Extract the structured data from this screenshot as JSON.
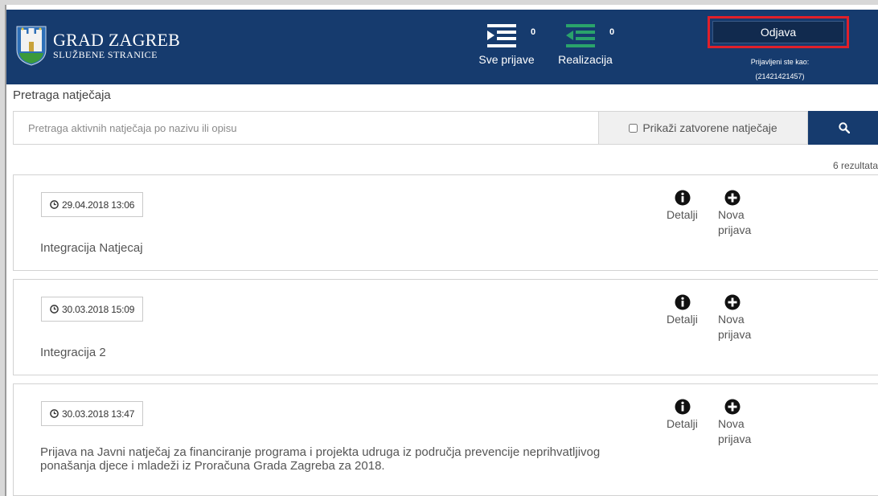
{
  "header": {
    "brand_title": "GRAD ZAGREB",
    "brand_subtitle": "SLUŽBENE STRANICE",
    "nav": [
      {
        "label": "Sve prijave",
        "count": "0"
      },
      {
        "label": "Realizacija",
        "count": "0"
      }
    ],
    "logout_label": "Odjava",
    "logged_in_as": "Prijavljeni ste kao:",
    "user_id": "(21421421457)"
  },
  "search": {
    "title": "Pretraga natječaja",
    "placeholder": "Pretraga aktivnih natječaja po nazivu ili opisu",
    "show_closed_label": "Prikaži zatvorene natječaje",
    "show_closed_checked": false,
    "results_count": "6 rezultata"
  },
  "actions": {
    "details_label": "Detalji",
    "new_application_label": "Nova prijava"
  },
  "tenders": [
    {
      "date": "29.04.2018 13:06",
      "title": "Integracija Natjecaj"
    },
    {
      "date": "30.03.2018 15:09",
      "title": "Integracija 2"
    },
    {
      "date": "30.03.2018 13:47",
      "title": "Prijava na Javni natječaj za financiranje programa i projekta udruga iz područja prevencije neprihvatljivog ponašanja djece i mladeži iz Proračuna Grada Zagreba za 2018."
    }
  ],
  "colors": {
    "header_bg": "#163b6e",
    "logout_highlight": "#e0202a",
    "nav_icon_realizacija": "#2aa36b"
  }
}
